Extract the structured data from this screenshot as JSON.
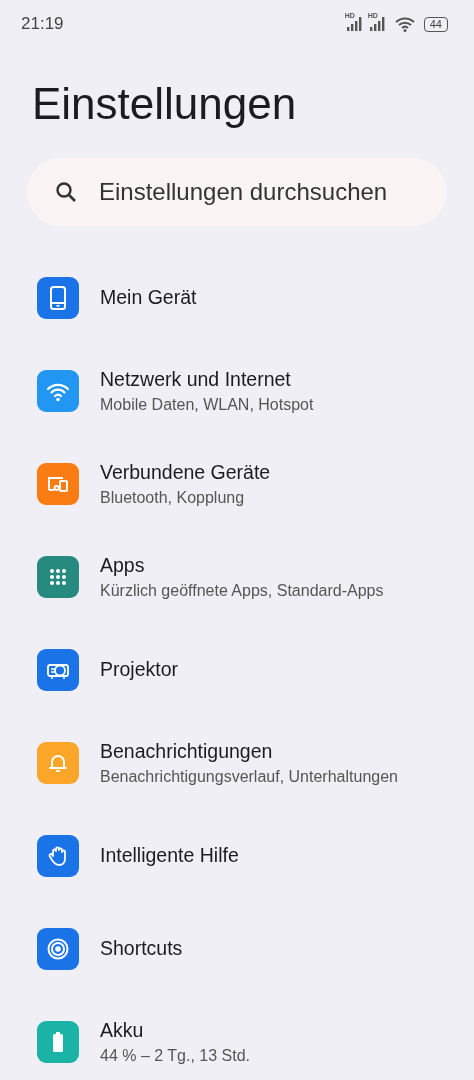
{
  "status_bar": {
    "time": "21:19",
    "sim_labels": [
      "HD",
      "HD"
    ],
    "battery": "44"
  },
  "title": "Einstellungen",
  "search": {
    "placeholder": "Einstellungen durchsuchen"
  },
  "items": [
    {
      "kind": "phone",
      "color": "#1b73e8",
      "title": "Mein Gerät"
    },
    {
      "kind": "wifi",
      "color": "#2196f3",
      "title": "Netzwerk und Internet",
      "subtitle": "Mobile Daten, WLAN, Hotspot"
    },
    {
      "kind": "devices",
      "color": "#fb7c12",
      "title": "Verbundene Geräte",
      "subtitle": "Bluetooth, Kopplung"
    },
    {
      "kind": "grid",
      "color": "#268a7e",
      "title": "Apps",
      "subtitle": "Kürzlich geöffnete Apps, Standard-Apps"
    },
    {
      "kind": "projector",
      "color": "#1b73e8",
      "title": "Projektor"
    },
    {
      "kind": "bell",
      "color": "#fba628",
      "title": "Benachrichtigungen",
      "subtitle": "Benachrichtigungsverlauf, Unterhaltungen"
    },
    {
      "kind": "hand",
      "color": "#1b73e8",
      "title": "Intelligente Hilfe"
    },
    {
      "kind": "target",
      "color": "#1b73e8",
      "title": "Shortcuts"
    },
    {
      "kind": "battery",
      "color": "#1ab3a6",
      "title": "Akku",
      "subtitle": "44 % – 2 Tg., 13 Std."
    }
  ]
}
